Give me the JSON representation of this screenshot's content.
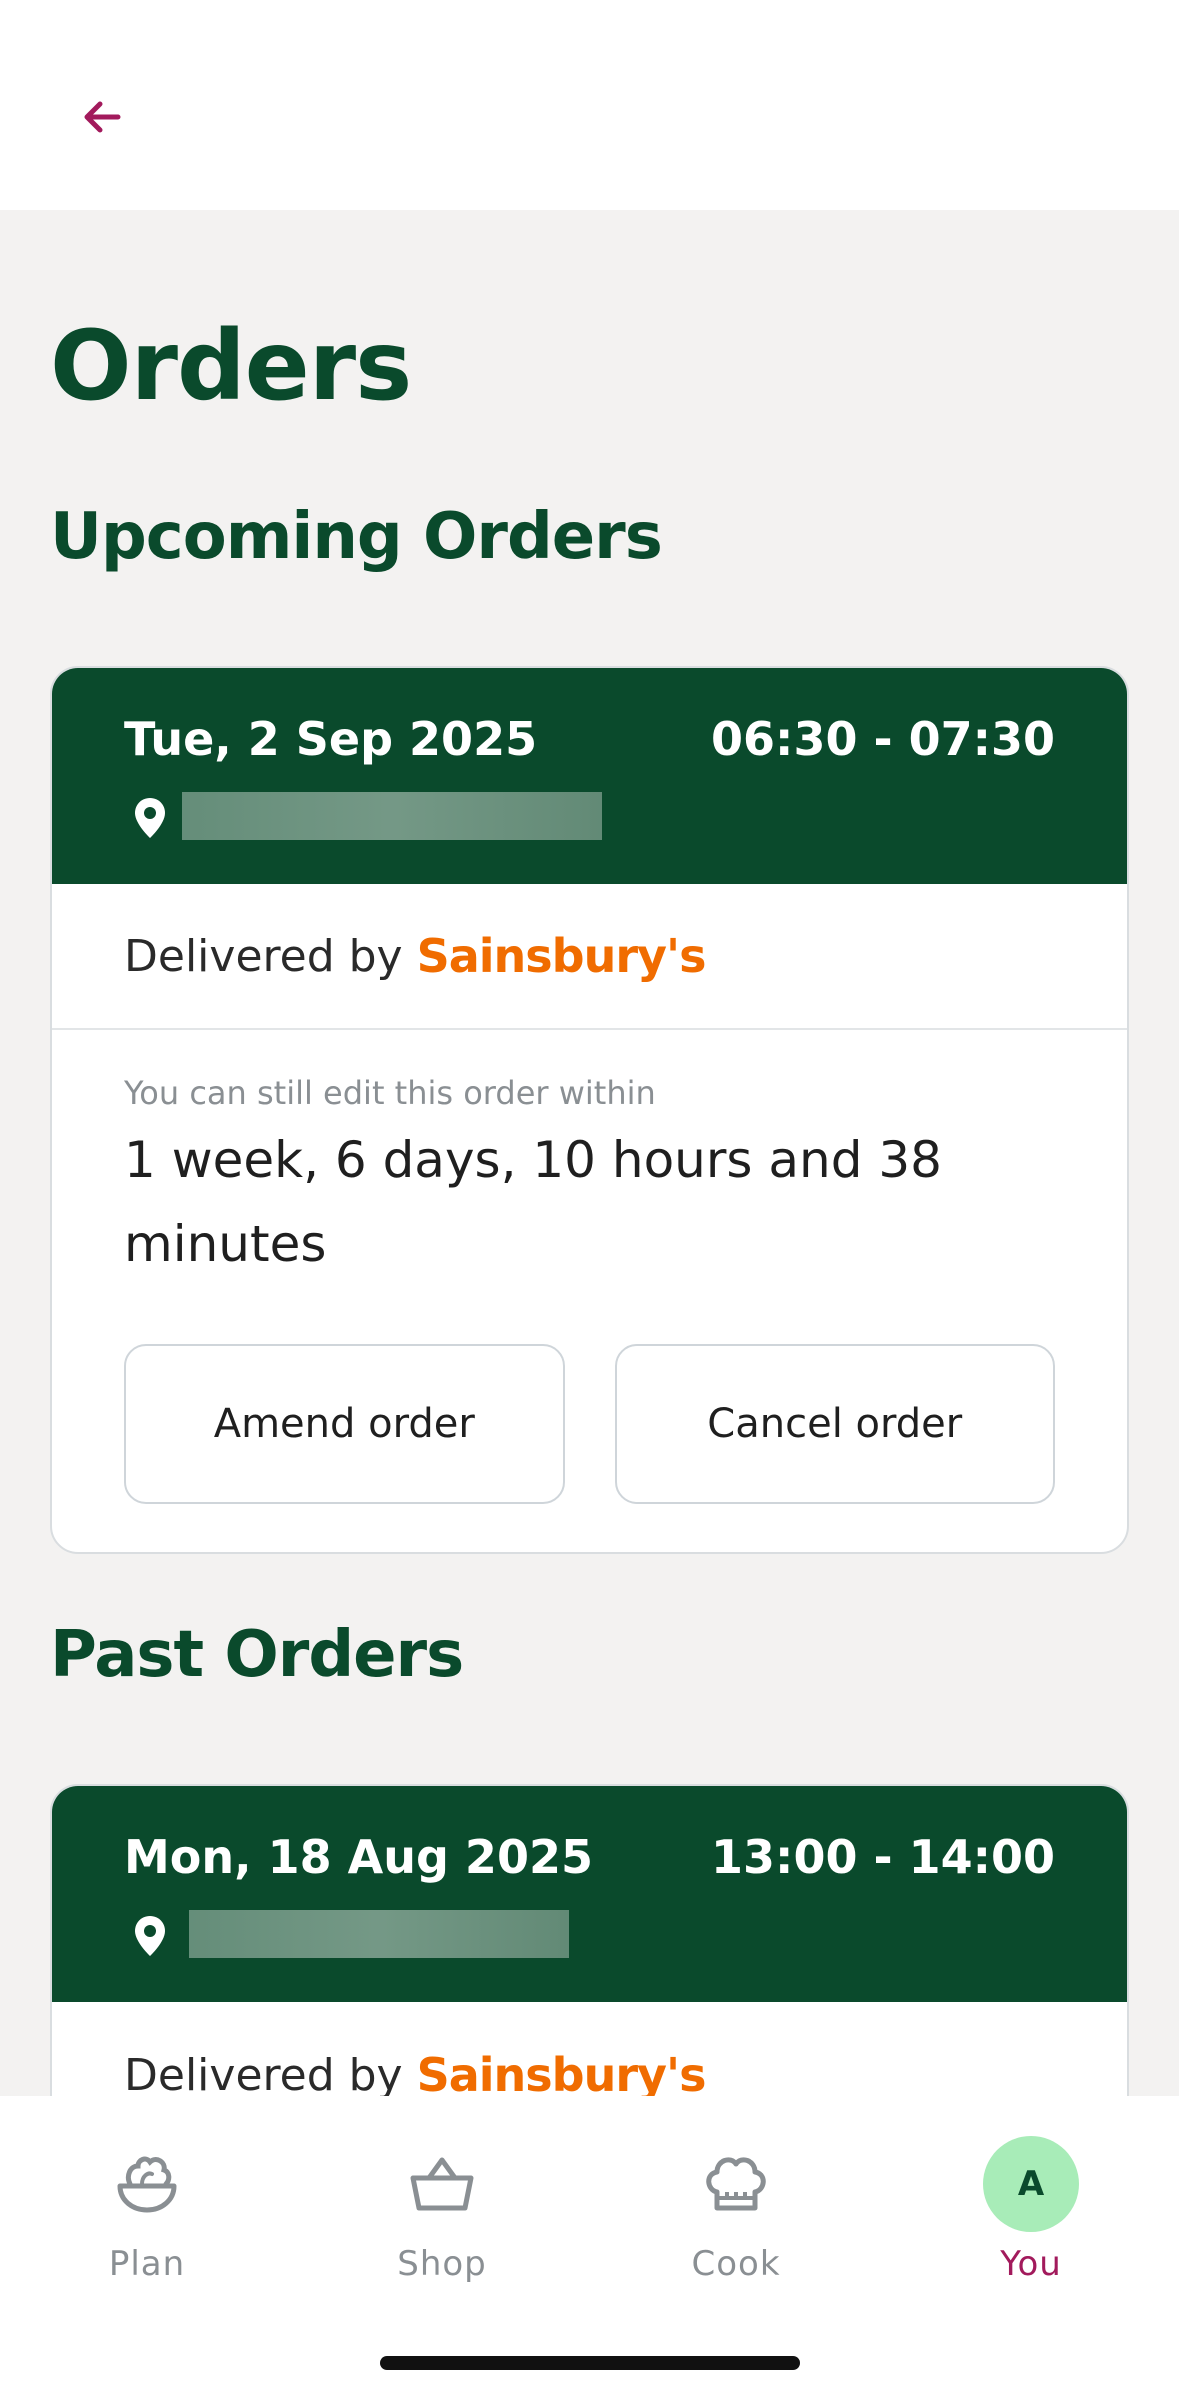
{
  "header": {
    "back_icon": "arrow-left-icon"
  },
  "page_title": "Orders",
  "upcoming": {
    "title": "Upcoming Orders",
    "order": {
      "date": "Tue, 2 Sep 2025",
      "time": "06:30 - 07:30",
      "delivered_by_label": "Delivered by",
      "retailer": "Sainsbury's",
      "edit_label": "You can still edit this order within",
      "edit_remaining": "1 week, 6 days, 10 hours and 38 minutes",
      "amend_label": "Amend order",
      "cancel_label": "Cancel order"
    }
  },
  "past": {
    "title": "Past Orders",
    "order": {
      "date": "Mon, 18 Aug 2025",
      "time": "13:00 - 14:00",
      "delivered_by_label": "Delivered by",
      "retailer": "Sainsbury's"
    }
  },
  "tabbar": {
    "items": [
      {
        "label": "Plan",
        "icon": "salad-bowl-icon"
      },
      {
        "label": "Shop",
        "icon": "basket-icon"
      },
      {
        "label": "Cook",
        "icon": "chef-hat-icon"
      },
      {
        "label": "You",
        "icon": "avatar",
        "avatar_initial": "A"
      }
    ],
    "active": "You"
  },
  "colors": {
    "brand_green": "#0a4a2c",
    "accent_magenta": "#a21a5c",
    "retailer_orange": "#f06c00",
    "avatar_bg": "#a8ecb8"
  }
}
